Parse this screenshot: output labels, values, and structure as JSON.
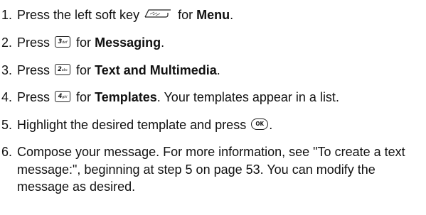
{
  "steps": [
    {
      "num": "1.",
      "pre": "Press the left soft key",
      "icon": "left-soft-key-icon",
      "mid": "for",
      "bold": "Menu",
      "post": "."
    },
    {
      "num": "2.",
      "pre": "Press",
      "key": {
        "digit": "3",
        "letters": "def"
      },
      "icon": "key-3-icon",
      "mid": "for",
      "bold": "Messaging",
      "post": "."
    },
    {
      "num": "3.",
      "pre": "Press",
      "key": {
        "digit": "2",
        "letters": "abc"
      },
      "icon": "key-2-icon",
      "mid": "for",
      "bold": "Text and Multimedia",
      "post": "."
    },
    {
      "num": "4.",
      "pre": "Press",
      "key": {
        "digit": "4",
        "letters": "ghi"
      },
      "icon": "key-4-icon",
      "mid": "for",
      "bold": "Templates",
      "post": ". Your templates appear in a list."
    },
    {
      "num": "5.",
      "pre": "Highlight the desired template and press",
      "icon": "ok-key-icon",
      "key_label": "OK",
      "post": "."
    },
    {
      "num": "6.",
      "text": "Compose your message. For more information, see \"To create a text message:\", beginning at step 5 on page 53. You can modify the message as desired."
    }
  ]
}
